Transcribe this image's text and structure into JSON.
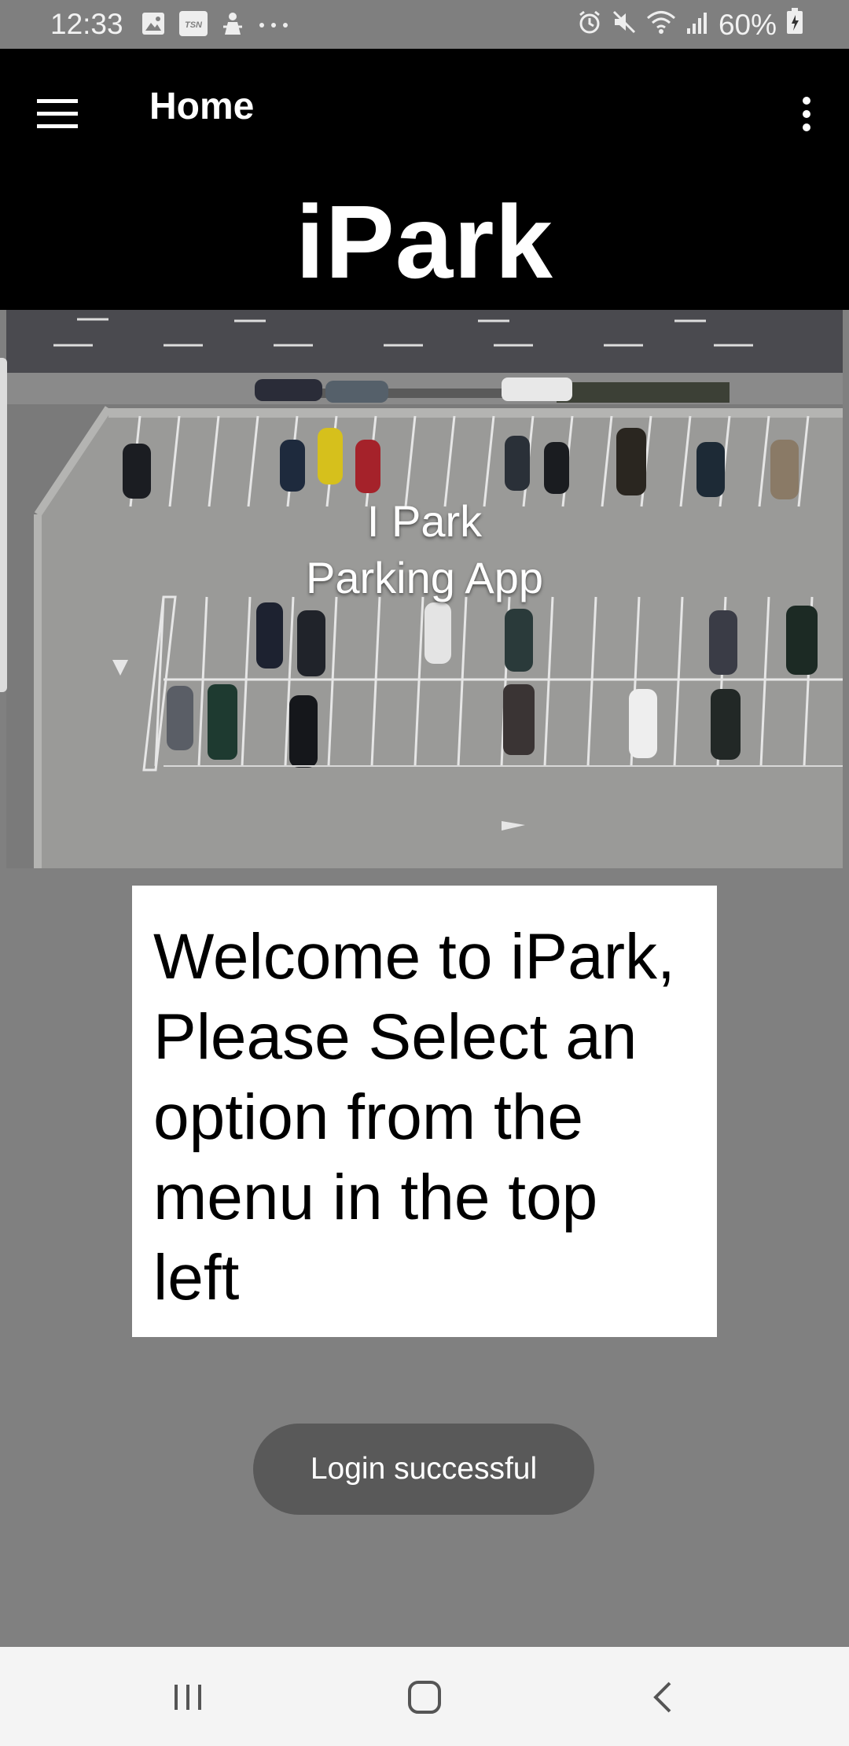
{
  "status_bar": {
    "time": "12:33",
    "battery": "60%",
    "left_icons": [
      "image-icon",
      "tsn-icon",
      "person-icon",
      "more-dots-icon"
    ],
    "right_icons": [
      "alarm-icon",
      "mute-icon",
      "wifi-icon",
      "signal-icon",
      "battery-icon"
    ]
  },
  "app_bar": {
    "title": "Home",
    "brand": "iPark",
    "menu_icon": "hamburger-menu-icon",
    "overflow_icon": "more-vert-icon"
  },
  "hero": {
    "line1": "I Park",
    "line2": "Parking App"
  },
  "welcome": {
    "text": "Welcome to iPark, Please Select an option from the menu in the top left"
  },
  "toast": {
    "text": "Login successful"
  },
  "nav_bar": {
    "buttons": [
      "recents-icon",
      "home-icon",
      "back-icon"
    ]
  },
  "colors": {
    "background": "#808080",
    "app_bar": "#000000",
    "card": "#ffffff",
    "toast": "#595959",
    "nav_bar": "#f4f4f4"
  }
}
